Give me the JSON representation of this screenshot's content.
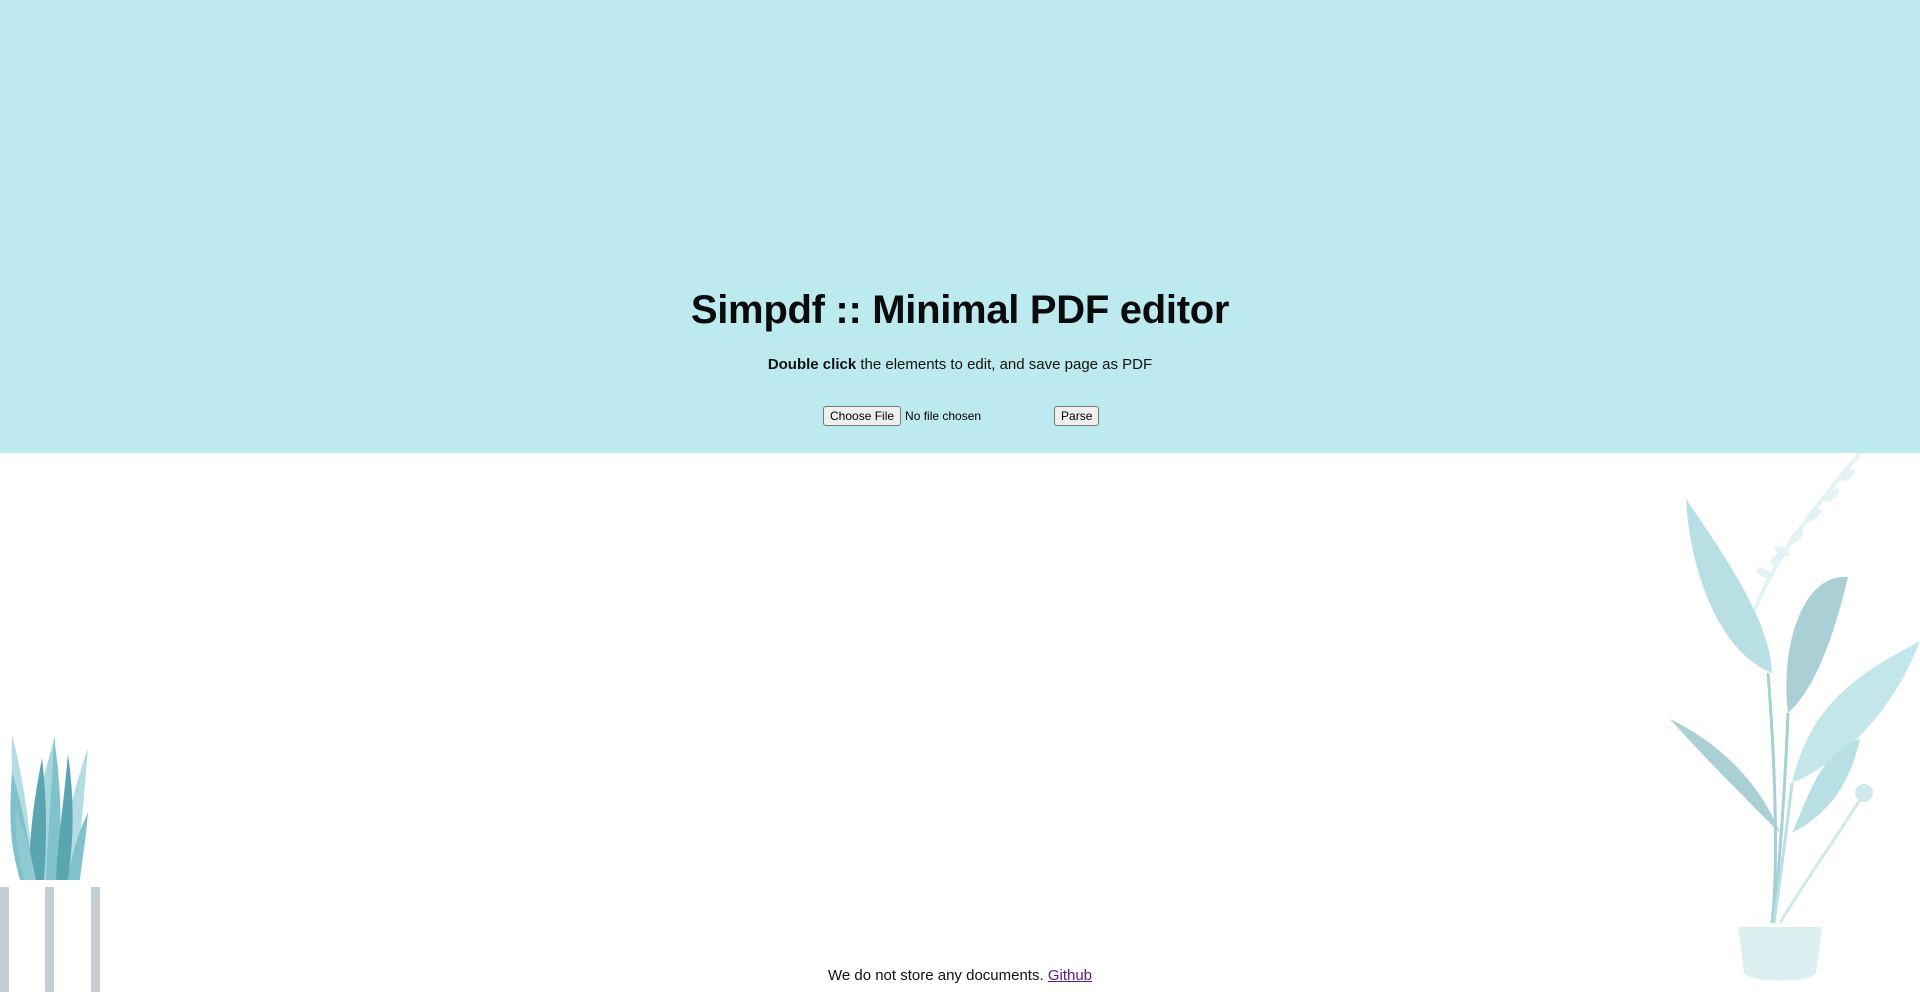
{
  "hero": {
    "title": "Simpdf :: Minimal PDF editor",
    "subtitle_bold": "Double click",
    "subtitle_rest": " the elements to edit, and save page as PDF",
    "background_color": "#bceaee"
  },
  "upload": {
    "choose_file_label": "Choose File",
    "file_status": "No file chosen",
    "parse_label": "Parse"
  },
  "footer": {
    "notice": "We do not store any documents.",
    "link_label": "Github",
    "link_color": "#551a8b"
  },
  "illustrations": {
    "left": "potted-grass-plant-illustration",
    "right": "tall-leaf-plant-illustration"
  }
}
